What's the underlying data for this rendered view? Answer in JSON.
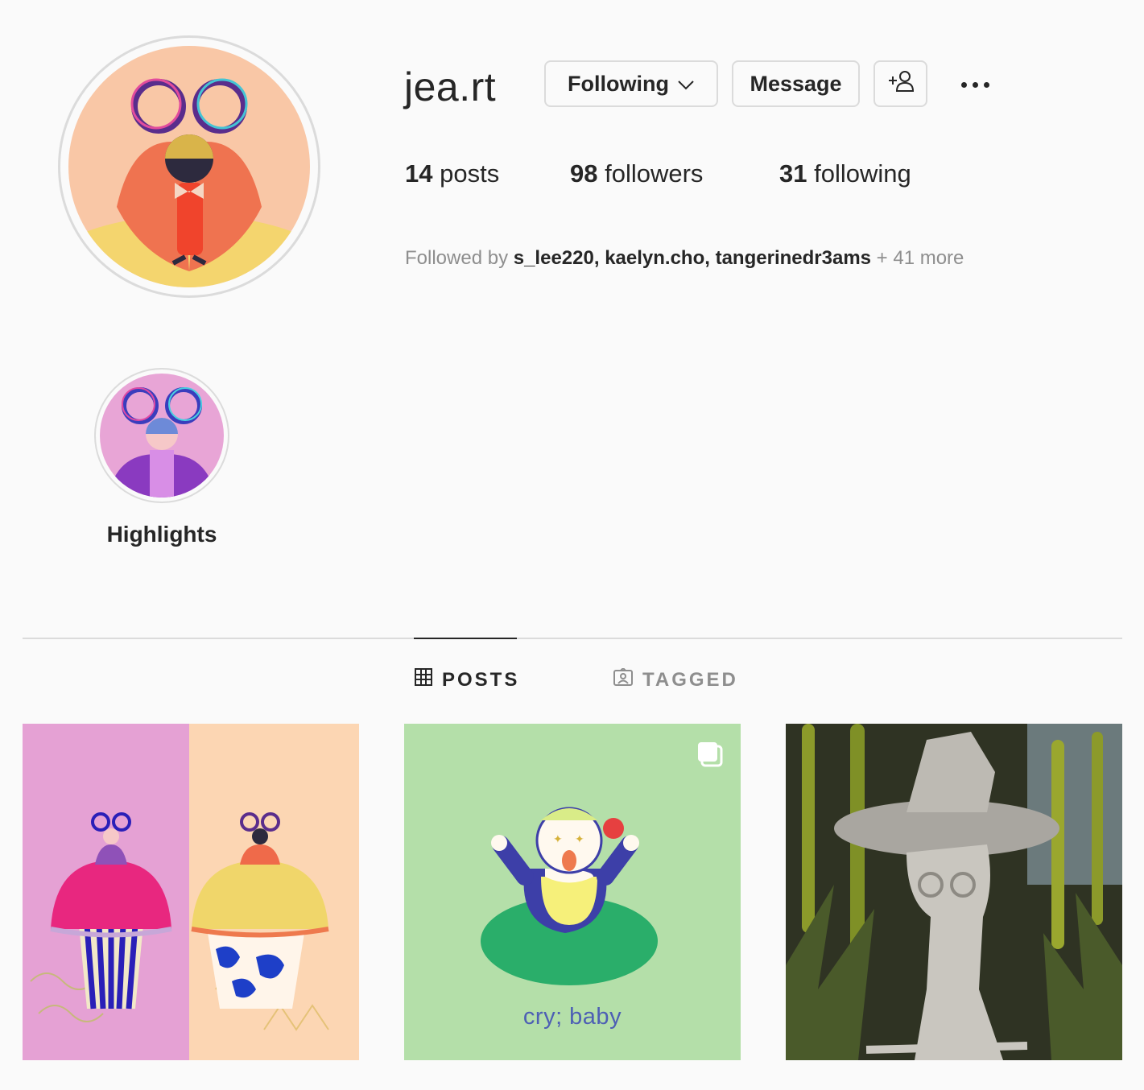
{
  "profile": {
    "username": "jea.rt",
    "following_button_label": "Following",
    "message_button_label": "Message",
    "stats": {
      "posts_count": "14",
      "posts_label": "posts",
      "followers_count": "98",
      "followers_label": "followers",
      "following_count": "31",
      "following_label": "following"
    },
    "followed_by": {
      "prefix": "Followed by",
      "users": [
        "s_lee220",
        "kaelyn.cho",
        "tangerinedr3ams"
      ],
      "separator": ",",
      "more": "+ 41 more"
    }
  },
  "highlights": [
    {
      "label": "Highlights"
    }
  ],
  "tabs": {
    "posts_label": "POSTS",
    "tagged_label": "TAGGED",
    "active": "POSTS"
  },
  "posts": [
    {
      "type": "image",
      "multi": false
    },
    {
      "type": "carousel",
      "multi": true,
      "caption": "cry; baby"
    },
    {
      "type": "image",
      "multi": false
    }
  ],
  "icons": {
    "chevron": "chevron-down-icon",
    "add_user": "add-person-icon",
    "more": "more-options-icon",
    "grid": "grid-icon",
    "tagged": "tagged-person-icon",
    "carousel": "carousel-icon"
  },
  "colors": {
    "text": "#262626",
    "secondary_text": "#8e8e8e",
    "border": "#dbdbdb",
    "background": "#fafafa",
    "caption_blue": "#4d5fb4"
  }
}
